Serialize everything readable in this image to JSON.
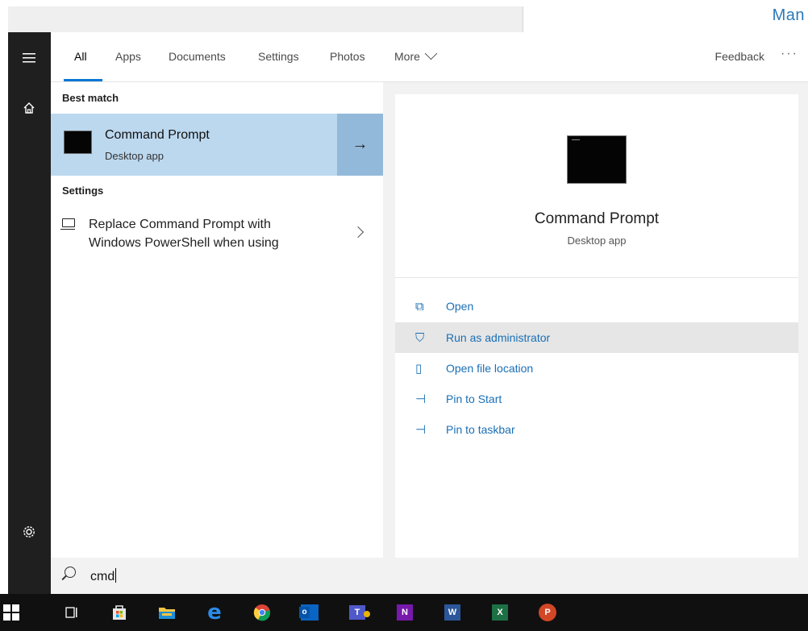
{
  "background": {
    "partial_title": "Man"
  },
  "tabs": {
    "all": "All",
    "apps": "Apps",
    "documents": "Documents",
    "settings": "Settings",
    "photos": "Photos",
    "more": "More",
    "feedback": "Feedback",
    "ellipsis": "···"
  },
  "results": {
    "best_match_header": "Best match",
    "best_match": {
      "title": "Command Prompt",
      "subtitle": "Desktop app",
      "arrow": "→"
    },
    "settings_header": "Settings",
    "settings_item": {
      "line1": "Replace Command Prompt with",
      "line2": "Windows PowerShell when using"
    }
  },
  "detail": {
    "title": "Command Prompt",
    "subtitle": "Desktop app",
    "actions": [
      {
        "label": "Open",
        "icon": "open-icon",
        "glyph": "⧉"
      },
      {
        "label": "Run as administrator",
        "icon": "shield-icon",
        "glyph": "⛉"
      },
      {
        "label": "Open file location",
        "icon": "file-location-icon",
        "glyph": "▯"
      },
      {
        "label": "Pin to Start",
        "icon": "pin-icon",
        "glyph": "⊣"
      },
      {
        "label": "Pin to taskbar",
        "icon": "pin-icon",
        "glyph": "⊣"
      }
    ],
    "highlighted_action": "Run as administrator"
  },
  "search": {
    "query": "cmd"
  },
  "taskbar": {
    "apps": [
      {
        "name": "task-view",
        "label": ""
      },
      {
        "name": "store",
        "label": ""
      },
      {
        "name": "file-explorer",
        "label": ""
      },
      {
        "name": "edge",
        "label": "e"
      },
      {
        "name": "chrome",
        "label": ""
      },
      {
        "name": "outlook",
        "label": "o"
      },
      {
        "name": "teams",
        "label": "T"
      },
      {
        "name": "onenote",
        "label": "N"
      },
      {
        "name": "word",
        "label": "W"
      },
      {
        "name": "excel",
        "label": "X"
      },
      {
        "name": "powerpoint",
        "label": "P"
      }
    ]
  },
  "colors": {
    "accent": "#0a78d4",
    "link": "#1a6fb5",
    "best_match_bg": "#bcd8ef",
    "best_match_arrow_bg": "#93b9da",
    "rail": "#1f1f1f",
    "taskbar": "#101010",
    "highlight_row": "#e6e6e6"
  }
}
